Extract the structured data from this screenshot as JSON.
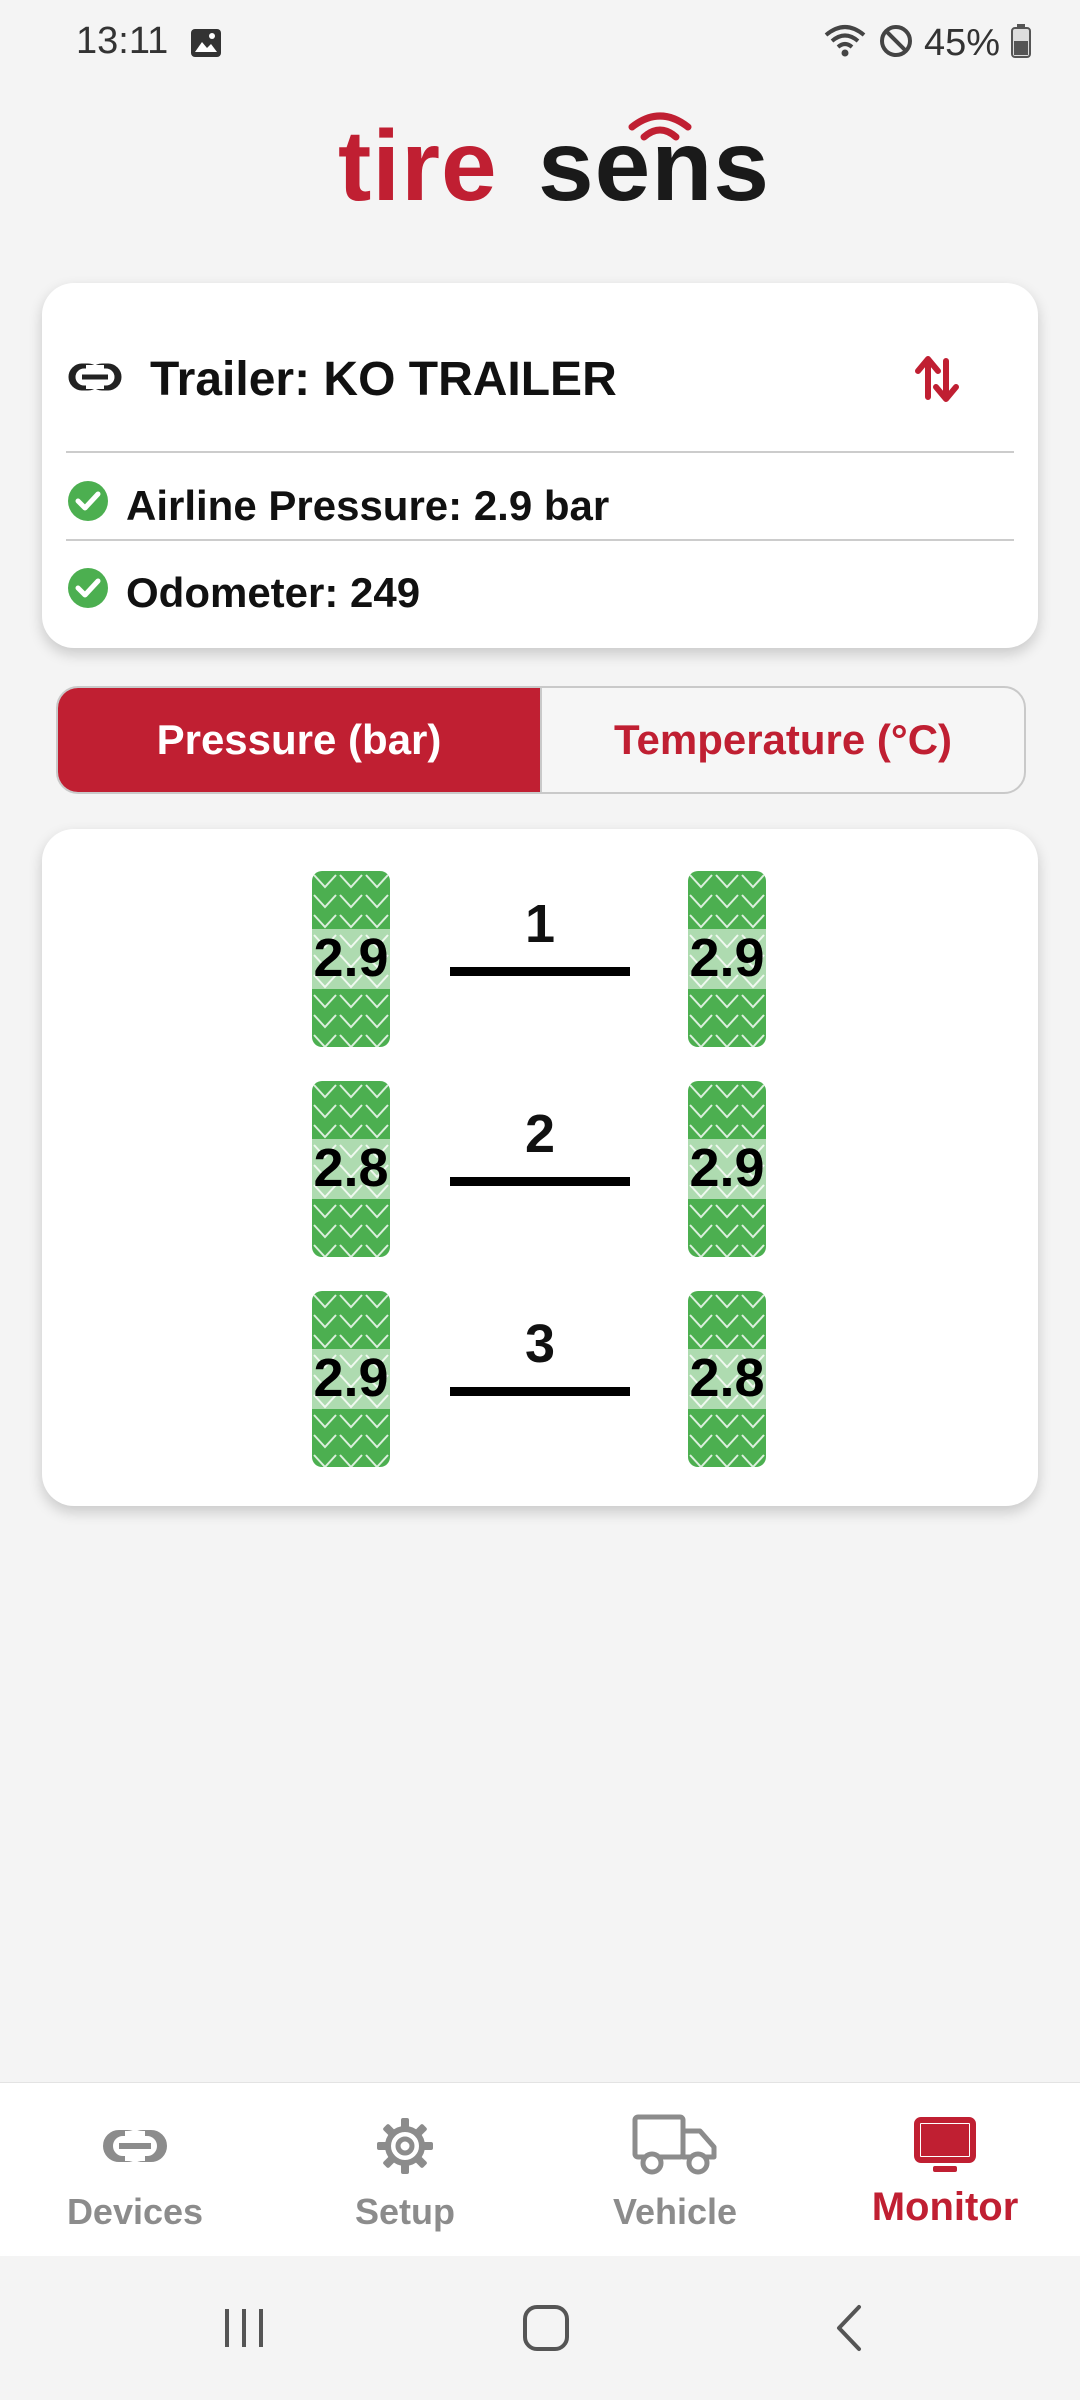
{
  "status": {
    "time": "13:11",
    "battery": "45%"
  },
  "logo": {
    "part1": "tire",
    "part2": "sens"
  },
  "trailer": {
    "title": "Trailer: KO TRAILER",
    "airline": "Airline Pressure: 2.9 bar",
    "odometer": "Odometer: 249"
  },
  "toggle": {
    "pressure": "Pressure (bar)",
    "temperature": "Temperature (°C)",
    "selected": "pressure"
  },
  "axles": [
    {
      "number": "1",
      "left": "2.9",
      "right": "2.9"
    },
    {
      "number": "2",
      "left": "2.8",
      "right": "2.9"
    },
    {
      "number": "3",
      "left": "2.9",
      "right": "2.8"
    }
  ],
  "nav": {
    "devices": "Devices",
    "setup": "Setup",
    "vehicle": "Vehicle",
    "monitor": "Monitor",
    "active": "monitor"
  },
  "colors": {
    "accent": "#c01f32",
    "ok": "#4caf50",
    "tire": "#4caf50"
  }
}
